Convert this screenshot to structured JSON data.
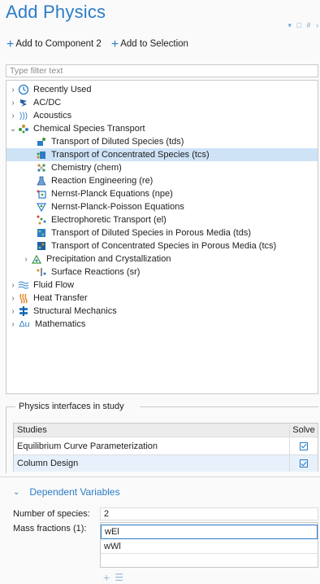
{
  "panel": {
    "title": "Add Physics",
    "window_controls": "▾ □ # ›"
  },
  "toolbar": {
    "add_component": "Add to Component 2",
    "add_selection": "Add to Selection"
  },
  "filter": {
    "placeholder": "Type filter text"
  },
  "tree": {
    "items": [
      {
        "label": "Recently Used",
        "icon": "clock-icon",
        "expanded": false
      },
      {
        "label": "AC/DC",
        "icon": "acdc-icon",
        "expanded": false
      },
      {
        "label": "Acoustics",
        "icon": "acoustics-icon",
        "expanded": false
      },
      {
        "label": "Chemical Species Transport",
        "icon": "chemical-species-icon",
        "expanded": true
      },
      {
        "label": "Transport of Diluted Species (tds)",
        "icon": "tds-icon"
      },
      {
        "label": "Transport of Concentrated Species (tcs)",
        "icon": "tcs-icon",
        "selected": true
      },
      {
        "label": "Chemistry (chem)",
        "icon": "chemistry-icon"
      },
      {
        "label": "Reaction Engineering (re)",
        "icon": "flask-icon"
      },
      {
        "label": "Nernst-Planck Equations (npe)",
        "icon": "npe-icon"
      },
      {
        "label": "Nernst-Planck-Poisson Equations",
        "icon": "npp-icon"
      },
      {
        "label": "Electrophoretic Transport (el)",
        "icon": "electrophoretic-icon"
      },
      {
        "label": "Transport of Diluted Species in Porous Media (tds)",
        "icon": "porous-tds-icon"
      },
      {
        "label": "Transport of Concentrated Species in Porous Media (tcs)",
        "icon": "porous-tcs-icon"
      },
      {
        "label": "Precipitation and Crystallization",
        "icon": "precipitation-icon",
        "expanded": false
      },
      {
        "label": "Surface Reactions (sr)",
        "icon": "surface-reactions-icon"
      },
      {
        "label": "Fluid Flow",
        "icon": "fluid-flow-icon",
        "expanded": false
      },
      {
        "label": "Heat Transfer",
        "icon": "heat-transfer-icon",
        "expanded": false
      },
      {
        "label": "Structural Mechanics",
        "icon": "structural-icon",
        "expanded": false
      },
      {
        "label": "Mathematics",
        "icon": "mathematics-icon",
        "expanded": false
      }
    ]
  },
  "physics_in_study": {
    "group_title": "Physics interfaces in study",
    "columns": [
      "Studies",
      "Solve"
    ],
    "rows": [
      {
        "name": "Equilibrium Curve Parameterization",
        "solve": true
      },
      {
        "name": "Column Design",
        "solve": true
      }
    ]
  },
  "dependent_variables": {
    "title": "Dependent Variables",
    "num_species_label": "Number of species:",
    "num_species_value": "2",
    "mass_fractions_label": "Mass fractions (1):",
    "mass_fractions": [
      "wEl",
      "wWl"
    ]
  },
  "colors": {
    "accent": "#2c7cc8",
    "selected_row": "#cfe3f7"
  }
}
